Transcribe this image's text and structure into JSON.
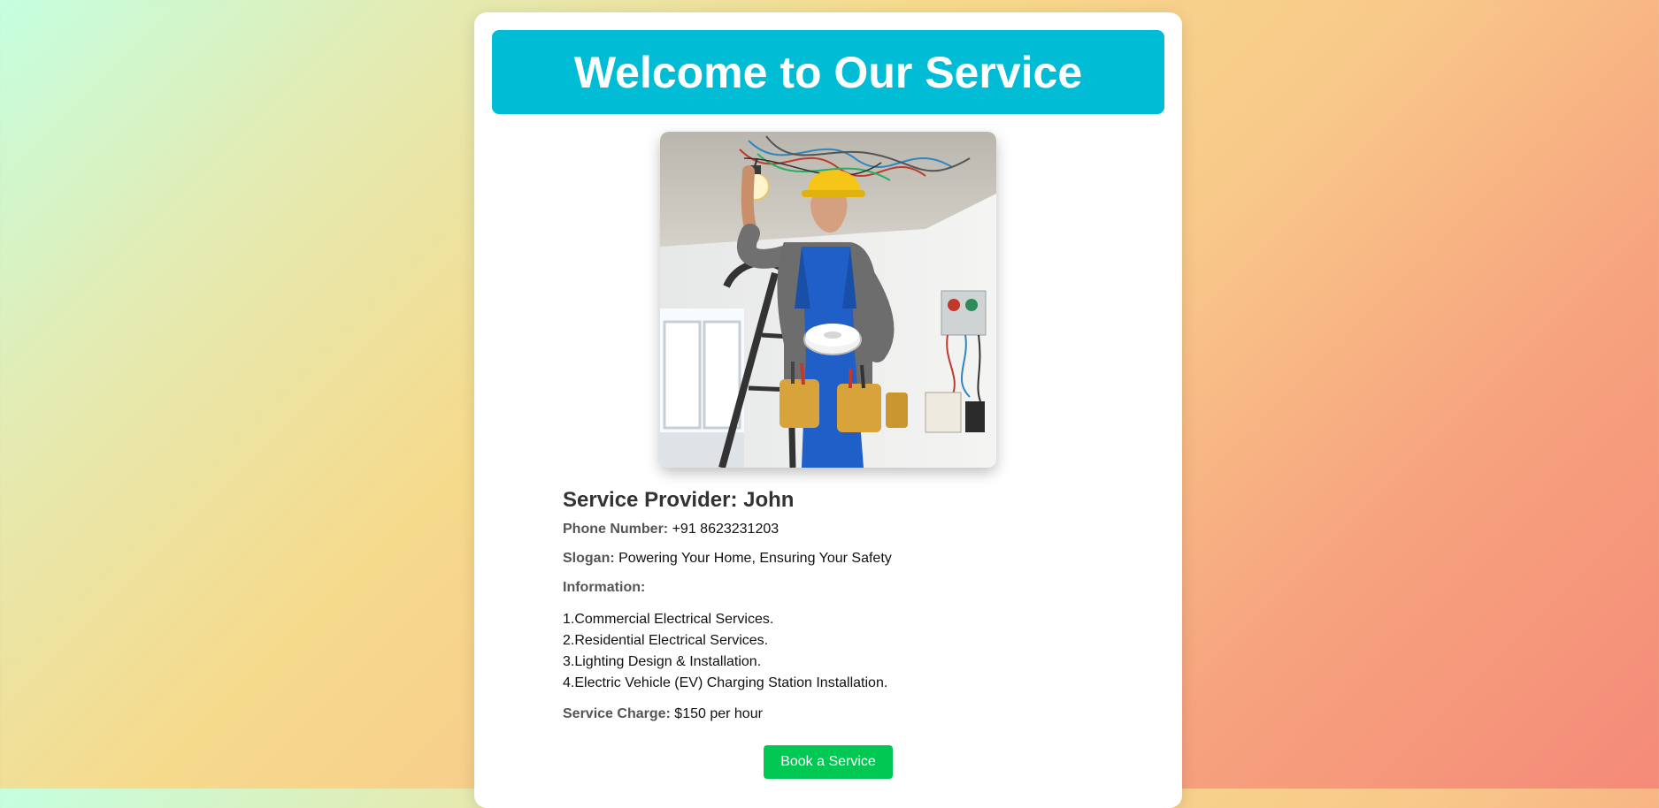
{
  "header": {
    "title": "Welcome to Our Service"
  },
  "provider": {
    "heading": "Service Provider: John",
    "phone_label": "Phone Number:",
    "phone_value": "+91 8623231203",
    "slogan_label": "Slogan:",
    "slogan_value": "Powering Your Home, Ensuring Your Safety",
    "info_label": "Information:",
    "info_items": [
      "1.Commercial Electrical Services.",
      "2.Residential Electrical Services.",
      "3.Lighting Design & Installation.",
      "4.Electric Vehicle (EV) Charging Station Installation."
    ],
    "charge_label": "Service Charge:",
    "charge_value": "$150 per hour"
  },
  "actions": {
    "book_label": "Book a Service"
  },
  "image": {
    "subject": "electrician-photo"
  },
  "colors": {
    "banner": "#00bcd4",
    "button": "#00c853"
  }
}
